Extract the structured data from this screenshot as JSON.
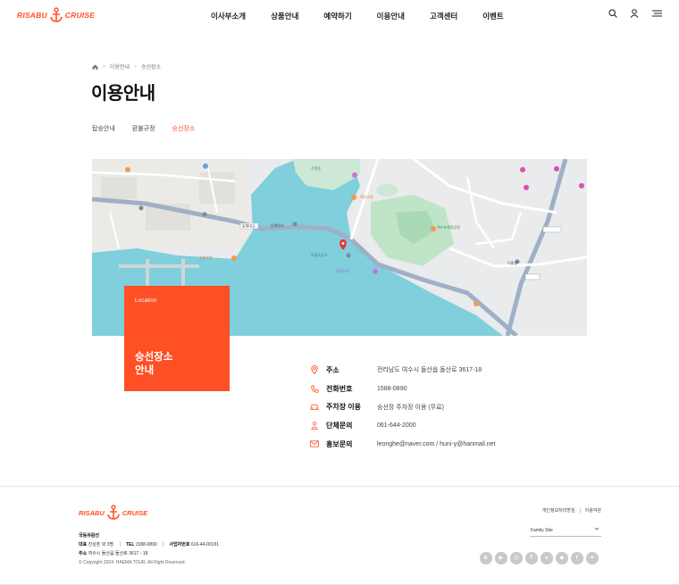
{
  "brand": {
    "name_left": "RISABU",
    "name_right": "CRUISE",
    "color": "#ff4f24"
  },
  "nav": {
    "items": [
      "이사부소개",
      "상품안내",
      "예약하기",
      "이용안내",
      "고객센터",
      "이벤트"
    ]
  },
  "header_icons": [
    "search-icon",
    "user-icon",
    "menu-icon"
  ],
  "breadcrumb": {
    "items": [
      "이용안내",
      "승선장소"
    ]
  },
  "page_title": "이용안내",
  "tabs": [
    {
      "label": "탑승안내",
      "active": false
    },
    {
      "label": "환불규정",
      "active": false
    },
    {
      "label": "승선장소",
      "active": true
    }
  ],
  "map": {
    "labels": [
      "동해대교",
      "동해대교",
      "오동도입구",
      "오동도역",
      "여수엑스포역",
      "엑스포해양공원",
      "신여수항",
      "해양공원",
      "수정동",
      "덕충동"
    ]
  },
  "location": {
    "small": "Location",
    "title_line1": "승선장소",
    "title_line2": "안내"
  },
  "info": [
    {
      "icon": "location-pin-icon",
      "label": "주소",
      "value": "전라남도 여수시 돌산읍 돌산로 3617-18"
    },
    {
      "icon": "phone-icon",
      "label": "전화번호",
      "value": "1588-0890"
    },
    {
      "icon": "car-icon",
      "label": "주차장 이용",
      "value": "승선장 주차장 이용 (무료)"
    },
    {
      "icon": "group-icon",
      "label": "단체문의",
      "value": "061-644-2000"
    },
    {
      "icon": "mail-icon",
      "label": "홍보문의",
      "value": "leonghe@naver.com / huni-y@hanmail.net"
    }
  ],
  "footer": {
    "company": "국동유람선",
    "ceo_label": "대표",
    "ceo": "진상훈 외 3명",
    "tel_label": "TEL",
    "tel": "1588-0890",
    "biz_label": "사업자번호",
    "biz": "616-44-00191",
    "addr_label": "주소",
    "addr": "여수시 돌산읍 돌산로 3617 - 18",
    "copyright": "© Copyright 2024. HAEMA TOUR. All Right Reserved.",
    "links": [
      "개인정보처리방침",
      "이용약관"
    ],
    "family_site": "Family Site",
    "social": [
      "blog-icon",
      "youtube-icon",
      "instagram-icon",
      "tstory-icon",
      "talk-icon",
      "pin-icon",
      "facebook-icon",
      "twitter-icon"
    ]
  }
}
